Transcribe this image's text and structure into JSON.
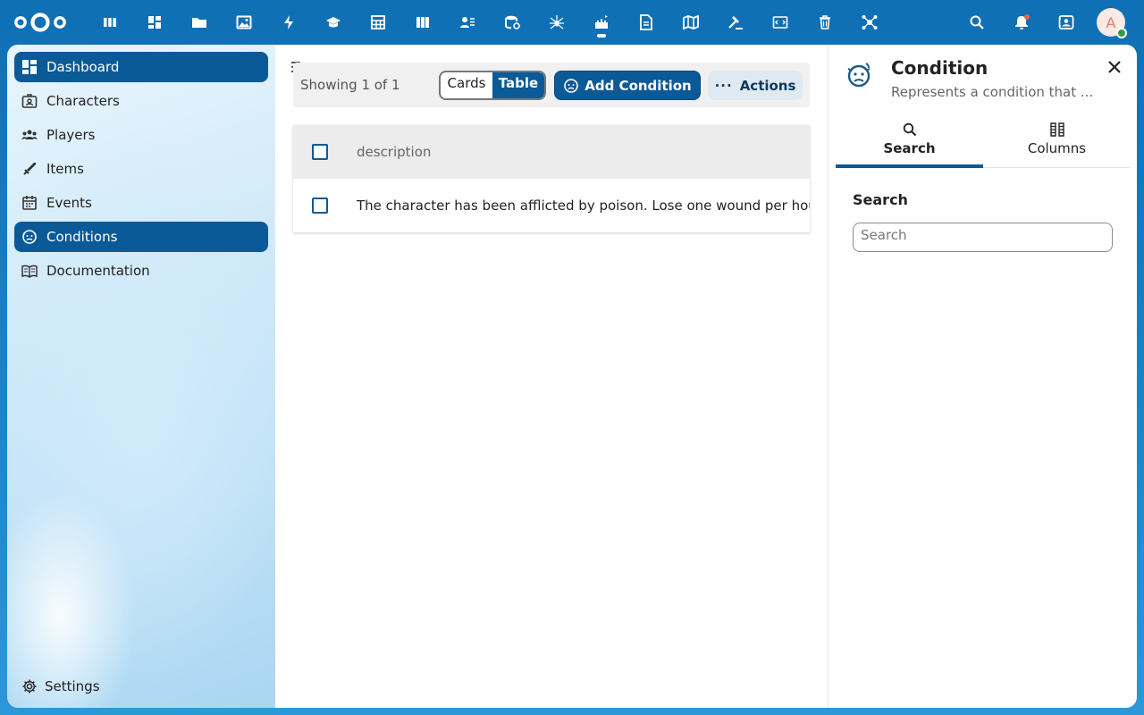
{
  "header": {
    "app_icons": [
      {
        "name": "deck-icon"
      },
      {
        "name": "dashboard-icon"
      },
      {
        "name": "files-icon"
      },
      {
        "name": "photos-icon"
      },
      {
        "name": "activity-icon"
      },
      {
        "name": "learning-icon"
      },
      {
        "name": "spreadsheet-icon"
      },
      {
        "name": "board-icon"
      },
      {
        "name": "contacts-icon"
      },
      {
        "name": "database-icon"
      },
      {
        "name": "spider-icon"
      },
      {
        "name": "castle-icon",
        "active": true
      },
      {
        "name": "document-icon"
      },
      {
        "name": "map-icon"
      },
      {
        "name": "gavel-icon"
      },
      {
        "name": "code-icon"
      },
      {
        "name": "trash-icon"
      },
      {
        "name": "network-icon"
      }
    ],
    "avatar_initial": "A"
  },
  "nav": {
    "items": [
      {
        "label": "Dashboard",
        "icon": "dashboard-icon",
        "selected": true
      },
      {
        "label": "Characters",
        "icon": "character-badge-icon"
      },
      {
        "label": "Players",
        "icon": "players-icon"
      },
      {
        "label": "Items",
        "icon": "sword-icon"
      },
      {
        "label": "Events",
        "icon": "calendar-icon"
      },
      {
        "label": "Conditions",
        "icon": "condition-face-icon",
        "selected": true
      },
      {
        "label": "Documentation",
        "icon": "book-icon"
      }
    ],
    "settings_label": "Settings"
  },
  "toolbar": {
    "showing": "Showing 1 of 1",
    "view_cards": "Cards",
    "view_table": "Table",
    "add_label": "Add Condition",
    "actions_label": "Actions",
    "actions_dots": "···"
  },
  "table": {
    "columns": [
      "description"
    ],
    "rows": [
      [
        "The character has been afflicted by poison. Lose one wound per hour until cured."
      ]
    ]
  },
  "sidebar": {
    "title": "Condition",
    "subtitle": "Represents a condition that ...",
    "tabs": [
      {
        "label": "Search",
        "icon": "search-icon",
        "active": true
      },
      {
        "label": "Columns",
        "icon": "columns-icon"
      }
    ],
    "search_label": "Search",
    "search_placeholder": "Search",
    "search_value": ""
  },
  "colors": {
    "primary": "#0b5a98",
    "header_bg": "#1a86cc",
    "notification": "#e9634b",
    "status_online": "#2d9d4a"
  }
}
